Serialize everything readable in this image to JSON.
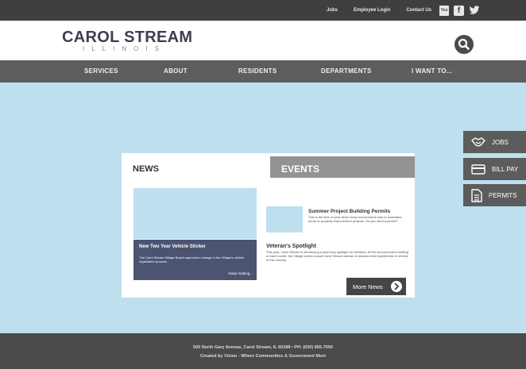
{
  "topbar": {
    "links": [
      "Jobs",
      "Employee Login",
      "Contact Us"
    ],
    "social": [
      {
        "icon": "youtube-icon",
        "text": "You"
      },
      {
        "icon": "facebook-icon",
        "text": "f"
      },
      {
        "icon": "twitter-icon"
      }
    ]
  },
  "header": {
    "logo_title": "CAROL STREAM",
    "logo_subtitle": "ILLINOIS",
    "search_icon": "search-icon"
  },
  "nav": {
    "items": [
      "SERVICES",
      "ABOUT",
      "RESIDENTS",
      "DEPARTMENTS",
      "I WANT TO..."
    ]
  },
  "side_buttons": [
    {
      "label": "JOBS",
      "icon": "handshake-icon"
    },
    {
      "label": "BILL PAY",
      "icon": "credit-card-icon"
    },
    {
      "label": "PERMITS",
      "icon": "document-icon"
    }
  ],
  "panel": {
    "news_tab": "NEWS",
    "events_tab": "EVENTS",
    "news_card": {
      "title": "New Two Year Vehicle Sticker",
      "body": "The Carol Stream Village Board approved a change in the Village's vehicle registration process.",
      "more": "Keep reading..."
    },
    "events": [
      {
        "title": "Summer Project Building Permits",
        "body": "This is the time of year when many homeowners look to undertake home or property improvement projects. Do you need a permit?"
      },
      {
        "title": "Veteran's Spotlight",
        "body": "This year, Carol Stream is introducing a year long spotlight on veterans. At the second board meeting of each month, the Village invites a local Carol Stream veteran to discuss their experiences in service of this country."
      }
    ],
    "more_news": "More News"
  },
  "footer": {
    "address": "500 North Gary Avenue, Carol Stream, IL 60188  •  PH: (630) 665-7050",
    "credit": "Created by Vision - Where Communities & Government Meet"
  },
  "colors": {
    "topbar": "#3f3f3f",
    "nav": "#5d5d5d",
    "hero": "#bedfee",
    "news_card": "#4c5471",
    "events_tab": "#939393",
    "footer": "#4a4a4a"
  }
}
